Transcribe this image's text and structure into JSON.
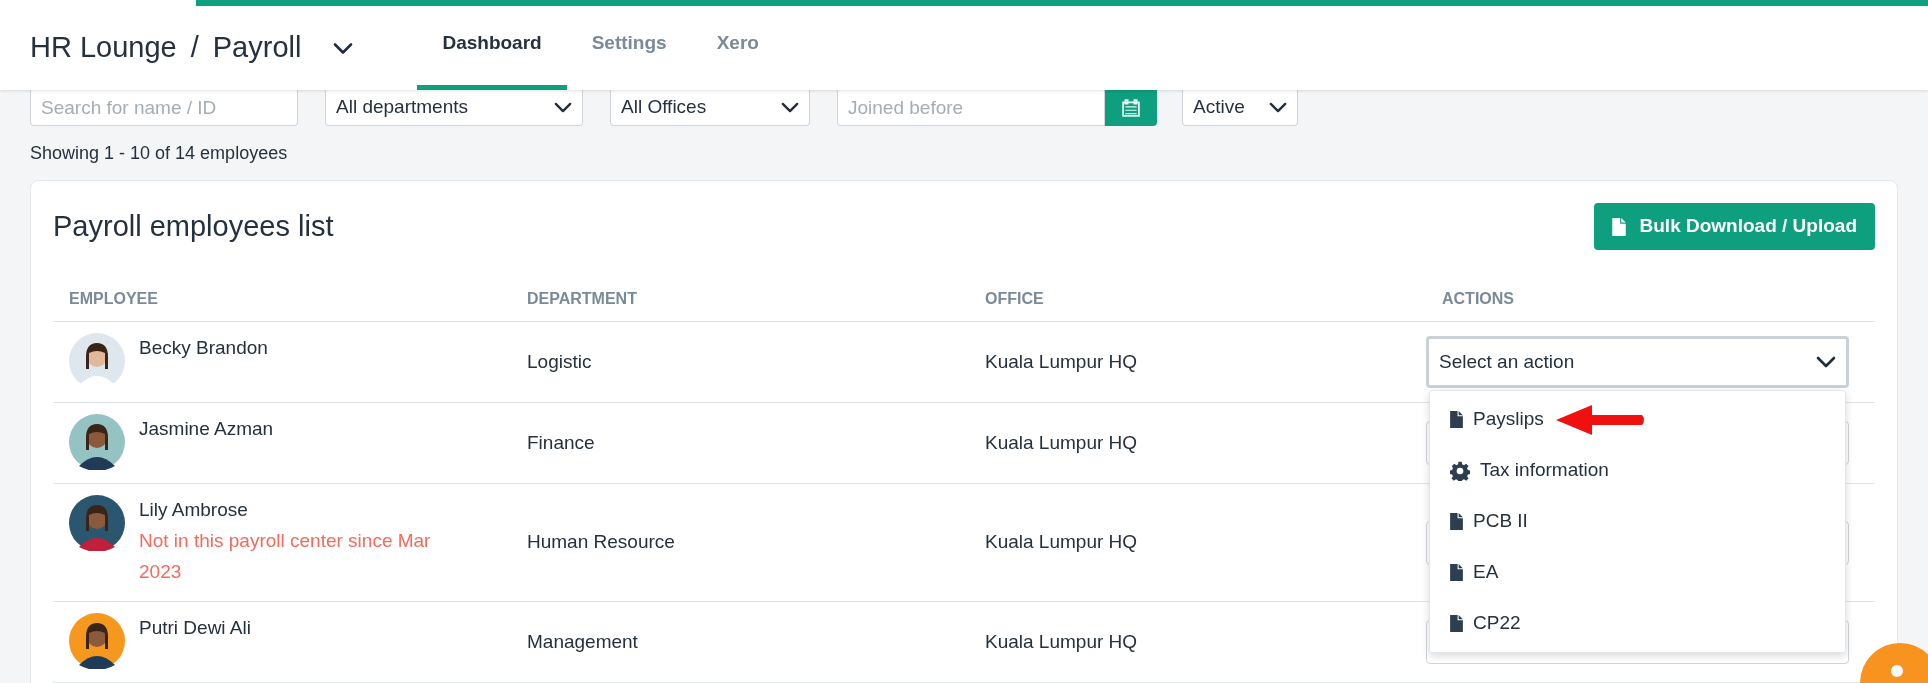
{
  "header": {
    "breadcrumb": [
      {
        "label": "HR Lounge"
      },
      {
        "label": "/"
      },
      {
        "label": "Payroll"
      }
    ],
    "tabs": [
      {
        "label": "Dashboard",
        "selected": true
      },
      {
        "label": "Settings",
        "selected": false
      },
      {
        "label": "Xero",
        "selected": false
      }
    ]
  },
  "filters": {
    "search": {
      "placeholder": "Search for name / ID"
    },
    "department": {
      "value": "All departments"
    },
    "office": {
      "value": "All Offices"
    },
    "joined": {
      "placeholder": "Joined before"
    },
    "status": {
      "value": "Active"
    }
  },
  "summary": "Showing 1 - 10 of 14 employees",
  "card": {
    "title": "Payroll employees list",
    "bulk_button": "Bulk Download / Upload",
    "columns": [
      "EMPLOYEE",
      "DEPARTMENT",
      "OFFICE",
      "ACTIONS"
    ],
    "rows": [
      {
        "name": "Becky Brandon",
        "note": null,
        "department": "Logistic",
        "office": "Kuala Lumpur HQ",
        "action": {
          "placeholder": "Select an action",
          "expanded": true
        }
      },
      {
        "name": "Jasmine Azman",
        "note": null,
        "department": "Finance",
        "office": "Kuala Lumpur HQ",
        "action": {
          "expanded": false
        }
      },
      {
        "name": "Lily Ambrose",
        "note": "Not in this payroll center since Mar 2023",
        "department": "Human Resource",
        "office": "Kuala Lumpur HQ",
        "action": {
          "expanded": false
        }
      },
      {
        "name": "Putri Dewi Ali",
        "note": null,
        "department": "Management",
        "office": "Kuala Lumpur HQ",
        "action": {
          "expanded": false
        }
      }
    ],
    "menu_items": [
      {
        "kind": "file",
        "label": "Payslips",
        "pointed": true
      },
      {
        "kind": "gear",
        "label": "Tax information",
        "pointed": false
      },
      {
        "kind": "file",
        "label": "PCB II",
        "pointed": false
      },
      {
        "kind": "file",
        "label": "EA",
        "pointed": false
      },
      {
        "kind": "file",
        "label": "CP22",
        "pointed": false
      }
    ]
  }
}
